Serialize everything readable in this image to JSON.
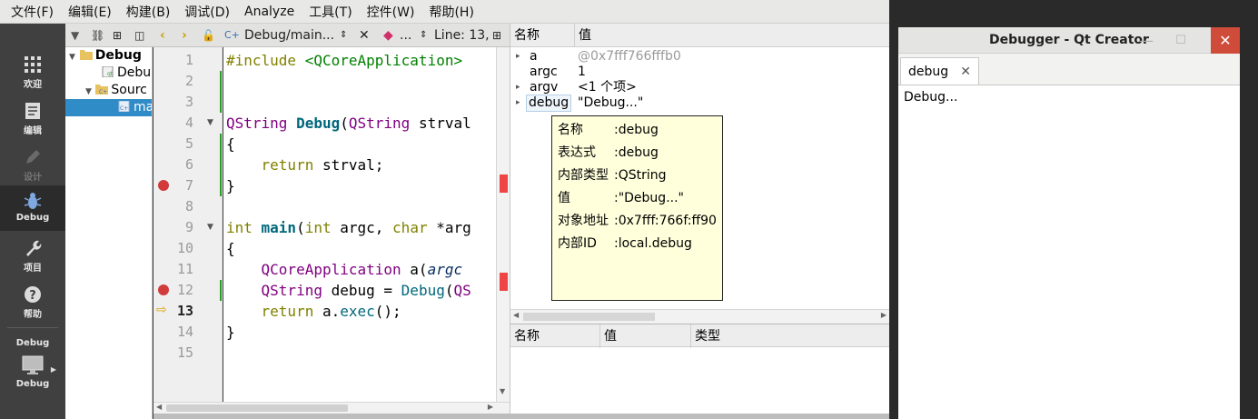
{
  "menu": [
    "文件(F)",
    "编辑(E)",
    "构建(B)",
    "调试(D)",
    "Analyze",
    "工具(T)",
    "控件(W)",
    "帮助(H)"
  ],
  "modes": [
    {
      "label": "欢迎",
      "icon": "grid-icon"
    },
    {
      "label": "编辑",
      "icon": "document-icon"
    },
    {
      "label": "设计",
      "icon": "pencil-icon"
    },
    {
      "label": "Debug",
      "icon": "bug-icon"
    },
    {
      "label": "项目",
      "icon": "wrench-icon"
    },
    {
      "label": "帮助",
      "icon": "help-icon"
    }
  ],
  "kit": {
    "top_label": "Debug",
    "bottom_label": "Debug"
  },
  "toolbar": {
    "file_combo": "Debug/main...",
    "symbol_combo": "...",
    "position": "Line: 13,"
  },
  "tree": {
    "project": "Debug",
    "pro_file": "Debu",
    "sources": "Sourc",
    "main_file": "ma"
  },
  "editor": {
    "line_numbers": [
      "1",
      "2",
      "3",
      "4",
      "5",
      "6",
      "7",
      "8",
      "9",
      "10",
      "11",
      "12",
      "13",
      "14",
      "15"
    ],
    "current_line": "13"
  },
  "code": {
    "l1_kw": "#include ",
    "l1_inc": "<QCoreApplication>",
    "l4_ty": "QString ",
    "l4_fn": "Debug",
    "l4_p": "(",
    "l4_ty2": "QString",
    "l4_rest": " strval",
    "l5": "{",
    "l6_kw": "return",
    "l6_rest": " strval;",
    "l7": "}",
    "l9_kw": "int ",
    "l9_fn": "main",
    "l9_p": "(",
    "l9_kw2": "int",
    "l9_mid": " argc, ",
    "l9_kw3": "char",
    "l9_rest": " *arg",
    "l10": "{",
    "l11_ty": "QCoreApplication",
    "l11_mid": " a(",
    "l11_it": "argc",
    "l12_ty": "QString",
    "l12_mid": " debug = ",
    "l12_call": "Debug",
    "l12_p": "(",
    "l12_ty2": "QS",
    "l13_kw": "return",
    "l13_mid": " a.",
    "l13_call": "exec",
    "l13_rest": "();",
    "l14": "}"
  },
  "locals": {
    "col_name": "名称",
    "col_value": "值",
    "rows": [
      {
        "name": "a",
        "value": "@0x7fff766fffb0"
      },
      {
        "name": "argc",
        "value": "1"
      },
      {
        "name": "argv",
        "value": "<1 个项>"
      },
      {
        "name": "debug",
        "value": "\"Debug...\""
      }
    ]
  },
  "tooltip": {
    "rows": [
      {
        "key": "名称",
        "value": ":debug"
      },
      {
        "key": "表达式",
        "value": ":debug"
      },
      {
        "key": "内部类型",
        "value": ":QString"
      },
      {
        "key": "值",
        "value": ":\"Debug...\""
      },
      {
        "key": "对象地址",
        "value": ":0x7fff:766f:ff90"
      },
      {
        "key": "内部ID",
        "value": ":local.debug"
      }
    ]
  },
  "watchers": {
    "col_name": "名称",
    "col_value": "值",
    "col_type": "类型"
  },
  "output_window": {
    "title": "Debugger - Qt Creator",
    "tab": "debug",
    "text": "Debug..."
  },
  "colors": {
    "breakpoint": "#d23b3b",
    "selection": "#308cc6",
    "tooltip_bg": "#ffffdc",
    "close_button": "#cf4b3a"
  }
}
